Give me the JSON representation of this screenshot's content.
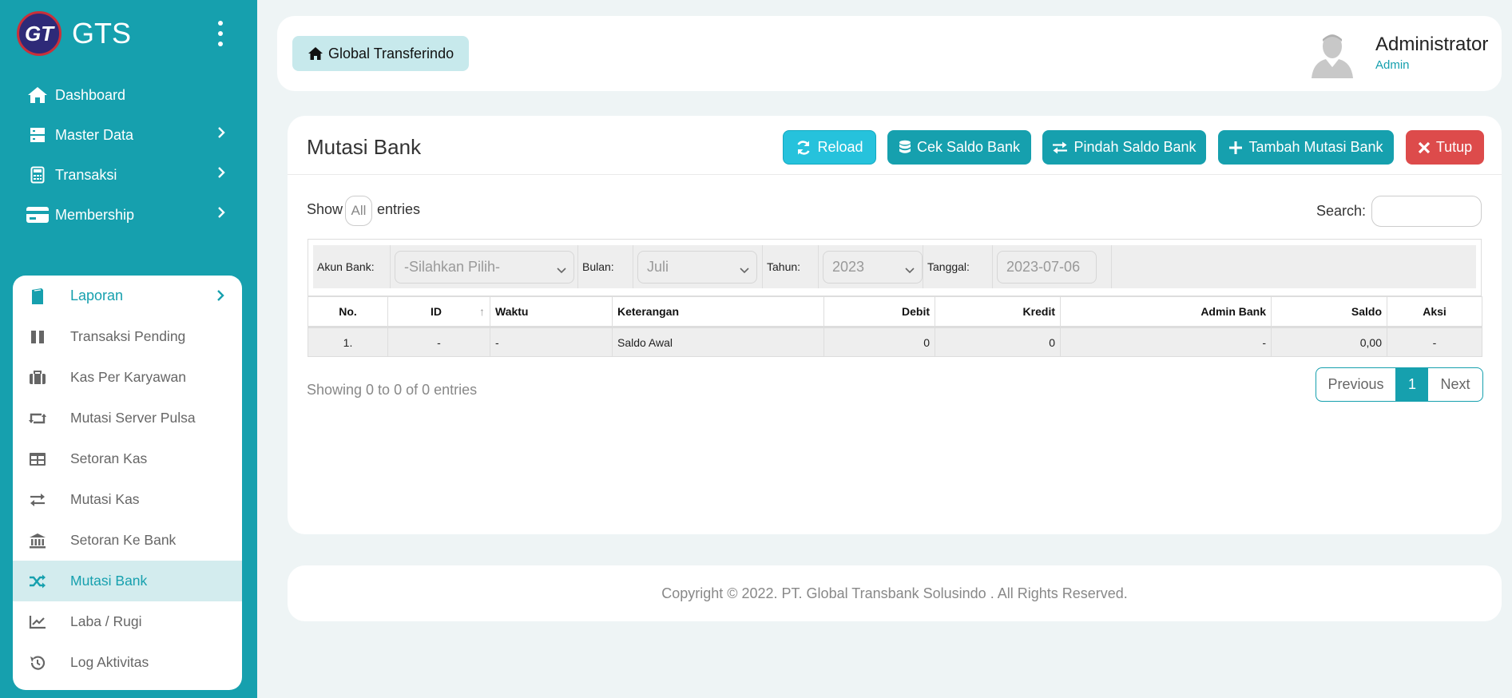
{
  "brand": {
    "name": "GTS",
    "logo_text": "GT"
  },
  "nav_top": [
    {
      "label": "Dashboard",
      "icon": "home-icon"
    },
    {
      "label": "Master Data",
      "icon": "server-icon"
    },
    {
      "label": "Transaksi",
      "icon": "calculator-icon"
    },
    {
      "label": "Membership",
      "icon": "credit-card-icon"
    }
  ],
  "nav_panel": [
    {
      "label": "Laporan",
      "icon": "book-icon"
    },
    {
      "label": "Transaksi Pending",
      "icon": "pause-icon"
    },
    {
      "label": "Kas Per Karyawan",
      "icon": "briefcase-icon"
    },
    {
      "label": "Mutasi Server Pulsa",
      "icon": "retweet-icon"
    },
    {
      "label": "Setoran Kas",
      "icon": "table-icon"
    },
    {
      "label": "Mutasi Kas",
      "icon": "exchange-icon"
    },
    {
      "label": "Setoran Ke Bank",
      "icon": "bank-icon"
    },
    {
      "label": "Mutasi Bank",
      "icon": "random-icon"
    },
    {
      "label": "Laba / Rugi",
      "icon": "chart-line-icon"
    },
    {
      "label": "Log Aktivitas",
      "icon": "history-icon"
    }
  ],
  "header": {
    "breadcrumb": "Global Transferindo",
    "user_name": "Administrator",
    "user_role": "Admin"
  },
  "main": {
    "title": "Mutasi Bank",
    "buttons": {
      "reload": "Reload",
      "cek": "Cek Saldo Bank",
      "pindah": "Pindah Saldo Bank",
      "tambah": "Tambah Mutasi Bank",
      "tutup": "Tutup"
    },
    "show_label": "Show",
    "show_value": "All",
    "entries_label": "entries",
    "search_label": "Search:",
    "search_value": "",
    "filters": {
      "akun_label": "Akun Bank:",
      "akun_value": "-Silahkan Pilih-",
      "bulan_label": "Bulan:",
      "bulan_value": "Juli",
      "tahun_label": "Tahun:",
      "tahun_value": "2023",
      "tanggal_label": "Tanggal:",
      "tanggal_value": "2023-07-06"
    },
    "columns": [
      "No.",
      "ID",
      "Waktu",
      "Keterangan",
      "Debit",
      "Kredit",
      "Admin Bank",
      "Saldo",
      "Aksi"
    ],
    "rows": [
      [
        "1.",
        "-",
        "-",
        "Saldo Awal",
        "0",
        "0",
        "-",
        "0,00",
        "-"
      ]
    ],
    "info": "Showing 0 to 0 of 0 entries",
    "pager": {
      "prev": "Previous",
      "page": "1",
      "next": "Next"
    }
  },
  "footer": {
    "text": "Copyright © 2022. PT. Global Transbank Solusindo . All Rights Reserved."
  },
  "colors": {
    "accent": "#16a0ae",
    "danger": "#dd4b4b",
    "reload": "#26c2dc"
  }
}
